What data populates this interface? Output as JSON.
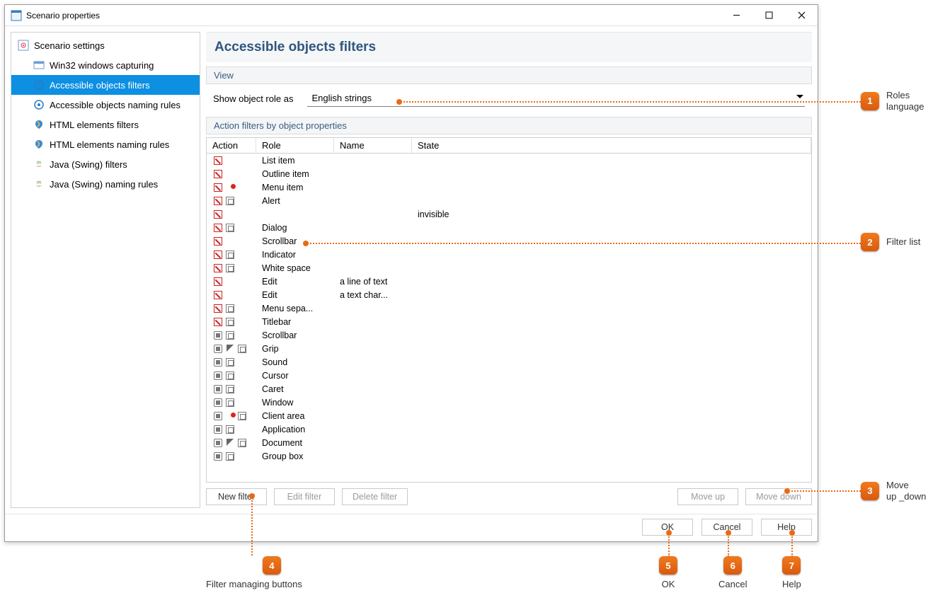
{
  "window": {
    "title": "Scenario properties"
  },
  "sidebar": {
    "root": "Scenario settings",
    "items": [
      "Win32 windows capturing",
      "Accessible objects filters",
      "Accessible objects naming rules",
      "HTML elements filters",
      "HTML elements naming rules",
      "Java (Swing) filters",
      "Java (Swing) naming rules"
    ],
    "selected_index": 1
  },
  "main": {
    "heading": "Accessible objects filters",
    "view_section": "View",
    "view_label": "Show object role as",
    "view_value": "English strings",
    "filters_section": "Action filters by object properties",
    "columns": [
      "Action",
      "Role",
      "Name",
      "State"
    ],
    "rows": [
      {
        "icons": [
          "stop"
        ],
        "role": "List item",
        "name": "",
        "state": ""
      },
      {
        "icons": [
          "stop"
        ],
        "role": "Outline item",
        "name": "",
        "state": ""
      },
      {
        "icons": [
          "stop",
          "red"
        ],
        "role": "Menu item",
        "name": "",
        "state": ""
      },
      {
        "icons": [
          "stop",
          "tree"
        ],
        "role": "Alert",
        "name": "",
        "state": ""
      },
      {
        "icons": [
          "stop"
        ],
        "role": "",
        "name": "",
        "state": "invisible"
      },
      {
        "icons": [
          "stop",
          "tree"
        ],
        "role": "Dialog",
        "name": "",
        "state": ""
      },
      {
        "icons": [
          "stop"
        ],
        "role": "Scrollbar",
        "name": "",
        "state": ""
      },
      {
        "icons": [
          "stop",
          "tree"
        ],
        "role": "Indicator",
        "name": "",
        "state": ""
      },
      {
        "icons": [
          "stop",
          "tree"
        ],
        "role": "White space",
        "name": "",
        "state": ""
      },
      {
        "icons": [
          "stop"
        ],
        "role": "Edit",
        "name": "a line of text",
        "state": ""
      },
      {
        "icons": [
          "stop"
        ],
        "role": "Edit",
        "name": "a text char...",
        "state": ""
      },
      {
        "icons": [
          "stop",
          "tree"
        ],
        "role": "Menu sepa...",
        "name": "",
        "state": ""
      },
      {
        "icons": [
          "stop",
          "tree"
        ],
        "role": "Titlebar",
        "name": "",
        "state": ""
      },
      {
        "icons": [
          "rec",
          "tree"
        ],
        "role": "Scrollbar",
        "name": "",
        "state": ""
      },
      {
        "icons": [
          "rec",
          "cur",
          "tree"
        ],
        "role": "Grip",
        "name": "",
        "state": ""
      },
      {
        "icons": [
          "rec",
          "tree"
        ],
        "role": "Sound",
        "name": "",
        "state": ""
      },
      {
        "icons": [
          "rec",
          "tree"
        ],
        "role": "Cursor",
        "name": "",
        "state": ""
      },
      {
        "icons": [
          "rec",
          "tree"
        ],
        "role": "Caret",
        "name": "",
        "state": ""
      },
      {
        "icons": [
          "rec",
          "tree"
        ],
        "role": "Window",
        "name": "",
        "state": ""
      },
      {
        "icons": [
          "rec",
          "red",
          "tree"
        ],
        "role": "Client area",
        "name": "",
        "state": ""
      },
      {
        "icons": [
          "rec",
          "tree"
        ],
        "role": "Application",
        "name": "",
        "state": ""
      },
      {
        "icons": [
          "rec",
          "cur",
          "tree"
        ],
        "role": "Document",
        "name": "",
        "state": ""
      },
      {
        "icons": [
          "rec",
          "tree"
        ],
        "role": "Group box",
        "name": "",
        "state": ""
      }
    ],
    "buttons": {
      "new": "New filter",
      "edit": "Edit filter",
      "delete": "Delete filter",
      "move_up": "Move up",
      "move_down": "Move down"
    }
  },
  "dialog_buttons": {
    "ok": "OK",
    "cancel": "Cancel",
    "help": "Help"
  },
  "callouts": {
    "1": {
      "n": "1",
      "label": "Roles\nlanguage"
    },
    "2": {
      "n": "2",
      "label": "Filter list"
    },
    "3": {
      "n": "3",
      "label": "Move\nup _down"
    },
    "4": {
      "n": "4",
      "label": "Filter managing buttons"
    },
    "5": {
      "n": "5",
      "label": "OK"
    },
    "6": {
      "n": "6",
      "label": "Cancel"
    },
    "7": {
      "n": "7",
      "label": "Help"
    }
  }
}
